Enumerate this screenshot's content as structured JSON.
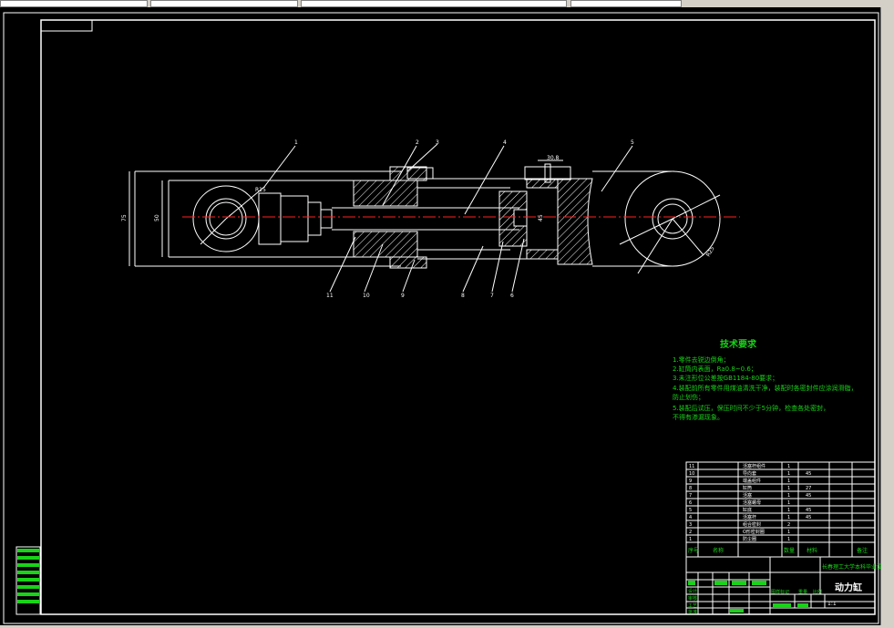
{
  "drawing": {
    "title_text": "动力缸",
    "scale": "1:1",
    "dimensions": {
      "cap_width": "30.8",
      "bore_left": "R15",
      "bore_right": "R25",
      "height_outer": "75",
      "height_inner": "50",
      "piston": "45"
    },
    "balloons": [
      "1",
      "2",
      "3",
      "4",
      "5",
      "6",
      "7",
      "8",
      "9",
      "10",
      "11"
    ],
    "tech_requirements": {
      "title": "技术要求",
      "lines": [
        "1.零件去锐边倒角；",
        "2.缸筒内表面，Ra0.8~0.6；",
        "3.未注形位公差按GB1184-80要求；",
        "4.装配前所有零件用煤油清洗干净，装配时各密封件应涂润滑脂，",
        "  防止划伤；",
        "5.装配后试压，保压时间不少于5分钟，检查各处密封，",
        "  不得有渗漏现象。"
      ]
    },
    "bom": {
      "rows": [
        {
          "no": "11",
          "name": "活塞杆组件",
          "qty": "1",
          "mat": ""
        },
        {
          "no": "10",
          "name": "导向套",
          "qty": "1",
          "mat": "45"
        },
        {
          "no": "9",
          "name": "端盖组件",
          "qty": "1",
          "mat": ""
        },
        {
          "no": "8",
          "name": "缸筒",
          "qty": "1",
          "mat": "27"
        },
        {
          "no": "7",
          "name": "活塞",
          "qty": "1",
          "mat": "45"
        },
        {
          "no": "6",
          "name": "活塞螺母",
          "qty": "1",
          "mat": ""
        },
        {
          "no": "5",
          "name": "缸底",
          "qty": "1",
          "mat": "45"
        },
        {
          "no": "4",
          "name": "活塞杆",
          "qty": "1",
          "mat": "45"
        },
        {
          "no": "3",
          "name": "组合密封",
          "qty": "2",
          "mat": ""
        },
        {
          "no": "2",
          "name": "O形密封圈",
          "qty": "1",
          "mat": ""
        },
        {
          "no": "1",
          "name": "防尘圈",
          "qty": "1",
          "mat": ""
        }
      ],
      "header": {
        "no": "序号",
        "name": "名称",
        "qty": "数量",
        "mat": "材料",
        "note": "备注"
      },
      "project": "长春理工大学本科毕业设计",
      "footer_labels": [
        "设计",
        "审核",
        "工艺",
        "批准"
      ],
      "sheet_labels": [
        "图样标记",
        "重量",
        "比例"
      ]
    }
  }
}
